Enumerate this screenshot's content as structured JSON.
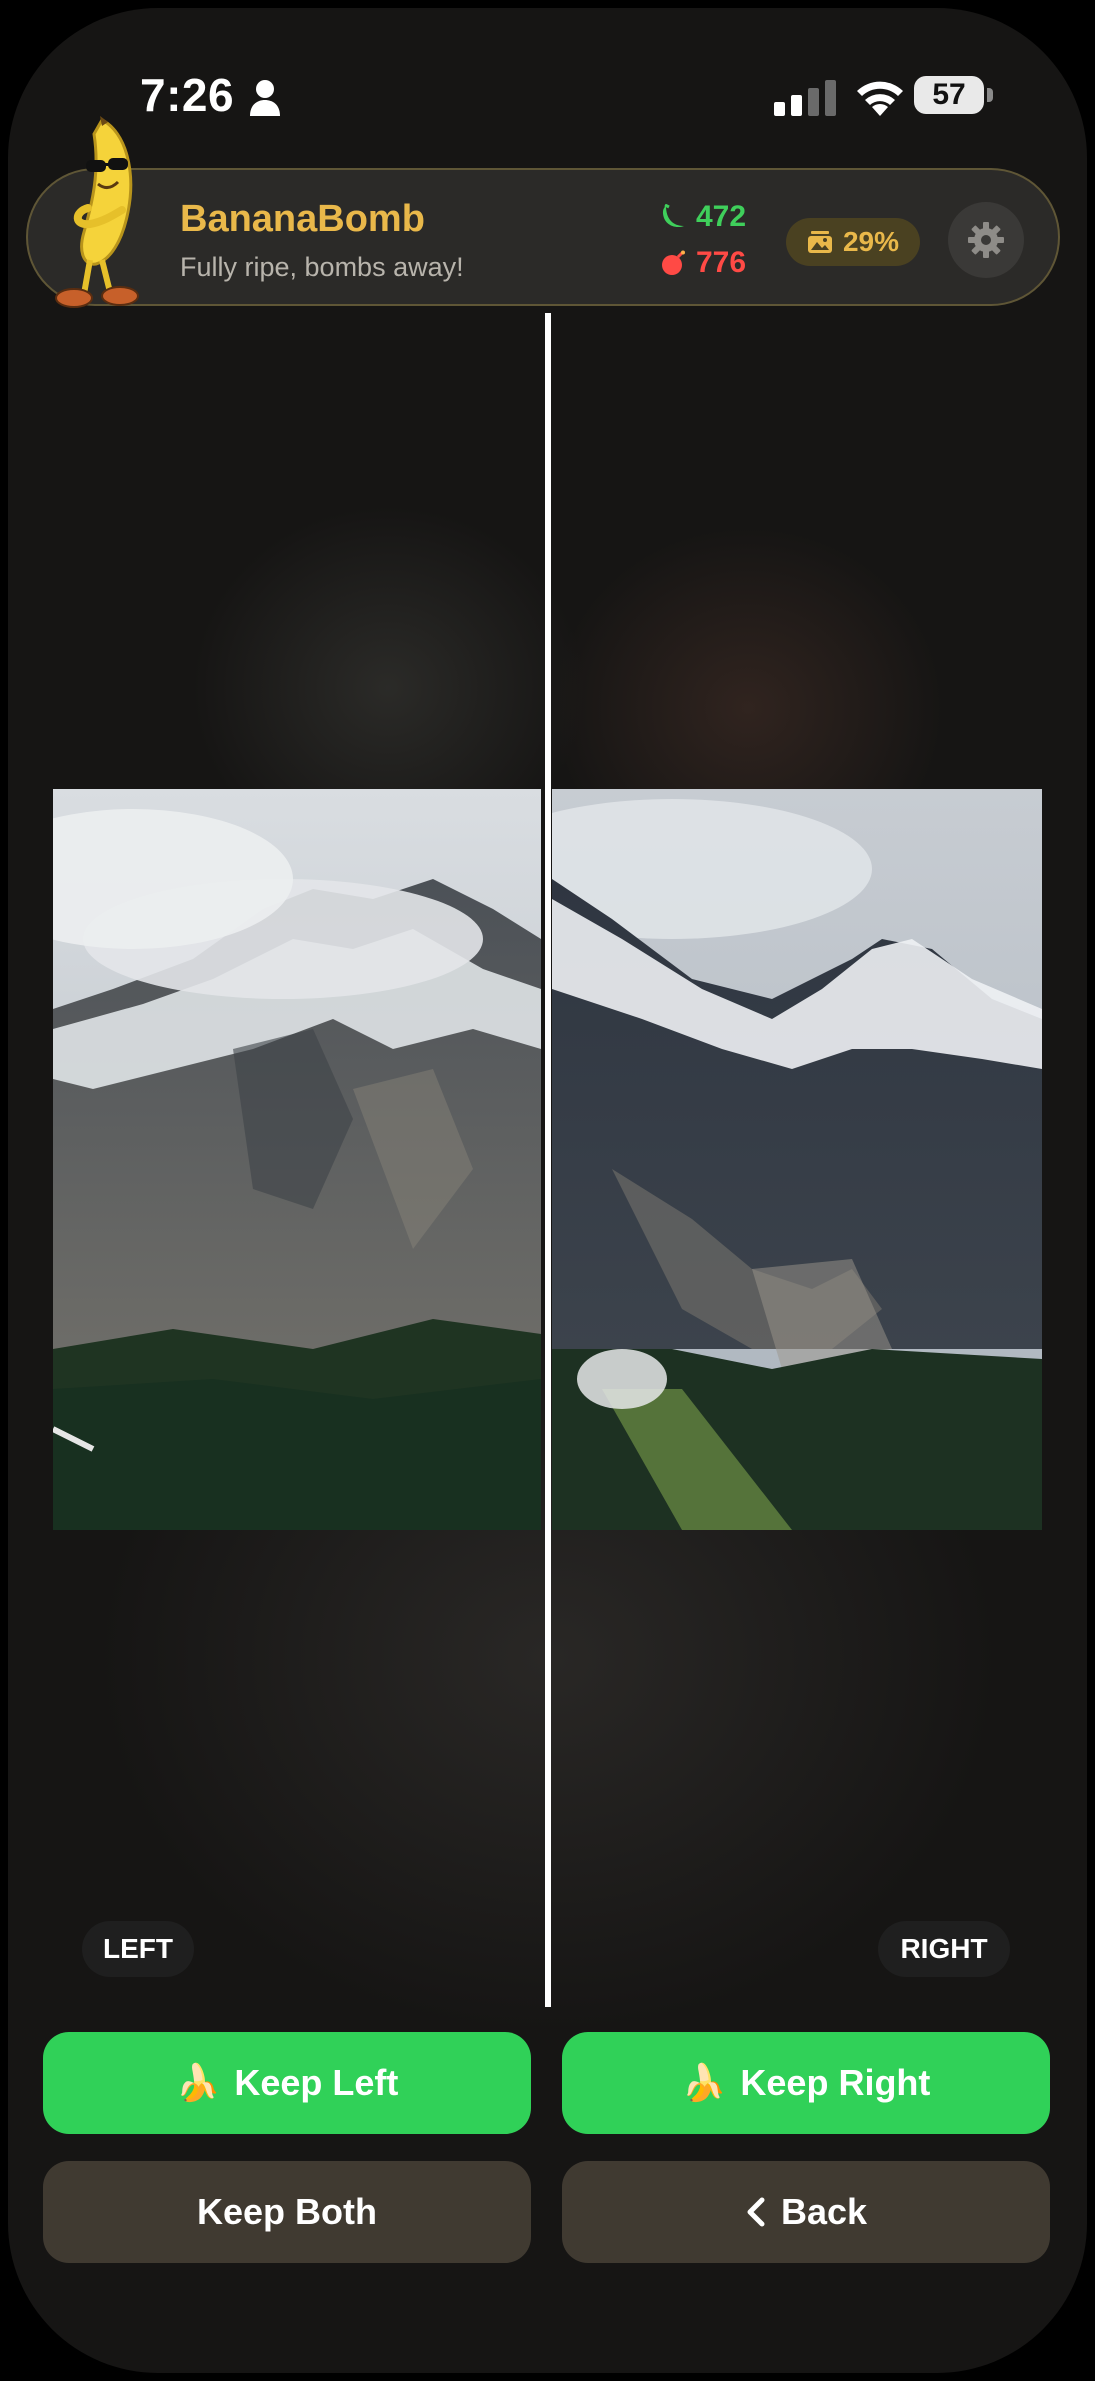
{
  "status_bar": {
    "time": "7:26",
    "battery": "57"
  },
  "header": {
    "title": "BananaBomb",
    "subtitle": "Fully ripe, bombs away!",
    "kept_count": "472",
    "deleted_count": "776",
    "progress": "29%",
    "progress_value": 0.29,
    "colors": {
      "title": "#e9b84a",
      "kept": "#3fcf5b",
      "deleted": "#ff4a45"
    }
  },
  "comparison": {
    "left_label": "LEFT",
    "right_label": "RIGHT"
  },
  "actions": {
    "keep_left": "Keep Left",
    "keep_right": "Keep Right",
    "keep_both": "Keep Both",
    "back": "Back",
    "emoji": "🍌",
    "colors": {
      "primary": "#30d158",
      "secondary": "#403a31"
    }
  },
  "icons": [
    "person-icon",
    "signal-icon",
    "wifi-icon",
    "battery-icon",
    "banana-mascot-icon",
    "banana-icon",
    "bomb-icon",
    "photo-icon",
    "gear-icon",
    "chevron-left-icon"
  ]
}
